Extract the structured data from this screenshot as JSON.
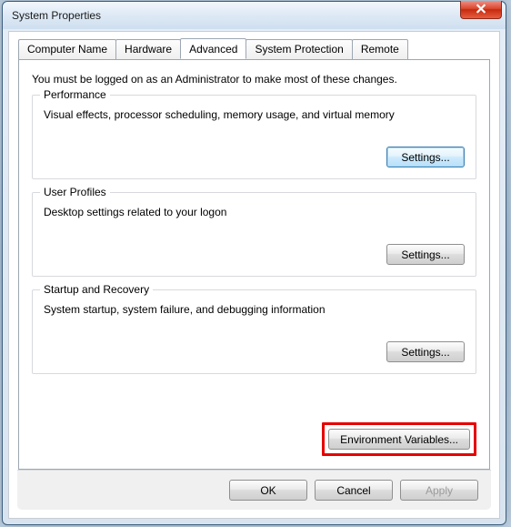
{
  "window": {
    "title": "System Properties"
  },
  "tabs": {
    "computer_name": "Computer Name",
    "hardware": "Hardware",
    "advanced": "Advanced",
    "system_protection": "System Protection",
    "remote": "Remote"
  },
  "advanced": {
    "intro": "You must be logged on as an Administrator to make most of these changes.",
    "performance": {
      "title": "Performance",
      "desc": "Visual effects, processor scheduling, memory usage, and virtual memory",
      "button": "Settings..."
    },
    "user_profiles": {
      "title": "User Profiles",
      "desc": "Desktop settings related to your logon",
      "button": "Settings..."
    },
    "startup": {
      "title": "Startup and Recovery",
      "desc": "System startup, system failure, and debugging information",
      "button": "Settings..."
    },
    "env_button": "Environment Variables..."
  },
  "buttons": {
    "ok": "OK",
    "cancel": "Cancel",
    "apply": "Apply"
  }
}
